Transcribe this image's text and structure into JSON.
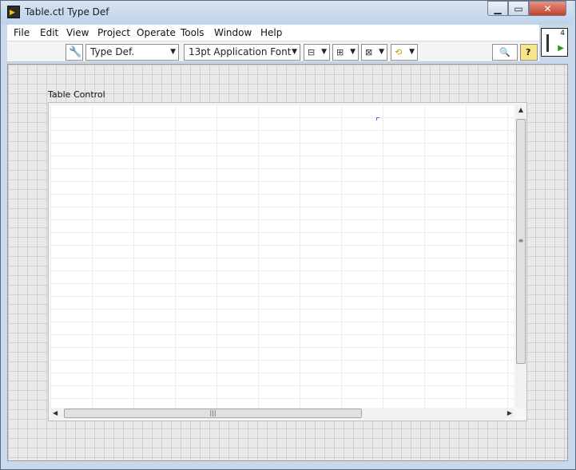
{
  "window": {
    "title": "Table.ctl Type Def",
    "app_icon": "labview-vi-icon",
    "controls": {
      "minimize": "minimize-icon",
      "maximize": "maximize-icon",
      "close": "close-icon"
    }
  },
  "menu": {
    "items": [
      {
        "label": "File"
      },
      {
        "label": "Edit"
      },
      {
        "label": "View"
      },
      {
        "label": "Project"
      },
      {
        "label": "Operate"
      },
      {
        "label": "Tools"
      },
      {
        "label": "Window"
      },
      {
        "label": "Help"
      }
    ]
  },
  "toolbar": {
    "wrench_icon": "wrench-icon",
    "control_type": "Type Def.",
    "font": "13pt Application Font",
    "align_icon": "align-objects-icon",
    "distribute_icon": "distribute-objects-icon",
    "resize_icon": "resize-objects-icon",
    "reorder_icon": "reorder-icon",
    "search_icon": "search-icon",
    "help_icon": "context-help-icon"
  },
  "connector_pane": {
    "terminal_count": "4"
  },
  "panel": {
    "table_label": "Table Control"
  }
}
